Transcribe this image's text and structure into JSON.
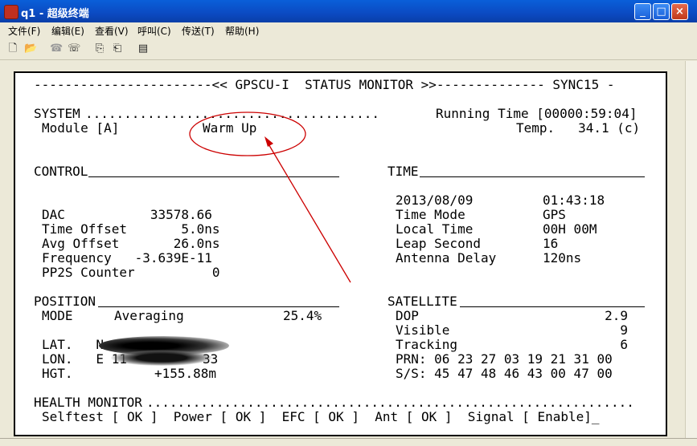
{
  "window": {
    "title": "q1 - 超级终端",
    "minimize": "_",
    "maximize": "□",
    "close": "×"
  },
  "menu": [
    "文件(F)",
    "编辑(E)",
    "查看(V)",
    "呼叫(C)",
    "传送(T)",
    "帮助(H)"
  ],
  "toolbar_icons": [
    "new-file-icon",
    "open-folder-icon",
    "call-icon",
    "disconnect-icon",
    "send-icon",
    "receive-icon",
    "properties-icon"
  ],
  "terminal": {
    "header": "-----------------------<< GPSCU-I  STATUS MONITOR >>-------------- SYNC15 -",
    "system_label": "SYSTEM",
    "system_dots": "......................................",
    "running_time": "Running Time [00000:59:04]",
    "module": "Module [A]",
    "status": "Warm Up",
    "temp": "Temp.   34.1 (c)",
    "control": {
      "label": "CONTROL",
      "rows": [
        "DAC           33578.66",
        "Time Offset       5.0ns",
        "Avg Offset       26.0ns",
        "Frequency   -3.639E-11",
        "PP2S Counter          0"
      ]
    },
    "time": {
      "label": "TIME",
      "rows": [
        "2013/08/09         01:43:18",
        "Time Mode          GPS",
        "Local Time         00H 00M",
        "Leap Second        16",
        "Antenna Delay      120ns"
      ]
    },
    "position": {
      "label": "POSITION",
      "mode_label": "MODE",
      "mode_value": "Averaging",
      "progress": "25.4%",
      "lat": "LAT.   N",
      "lon": "LON.   E 11",
      "lon_tail": "33",
      "hgt_label": "HGT.",
      "hgt_value": "+155.88m"
    },
    "satellite": {
      "label": "SATELLITE",
      "rows": [
        "DOP                        2.9",
        "Visible                      9",
        "Tracking                     6",
        "PRN: 06 23 27 03 19 21 31 00",
        "S/S: 45 47 48 46 43 00 47 00"
      ]
    },
    "health": {
      "label": "HEALTH MONITOR",
      "dots": "...............................................................",
      "line": "Selftest [ OK ]  Power [ OK ]  EFC [ OK ]  Ant [ OK ]  Signal [ Enable]_"
    }
  },
  "annotation_color": "#cc0000"
}
